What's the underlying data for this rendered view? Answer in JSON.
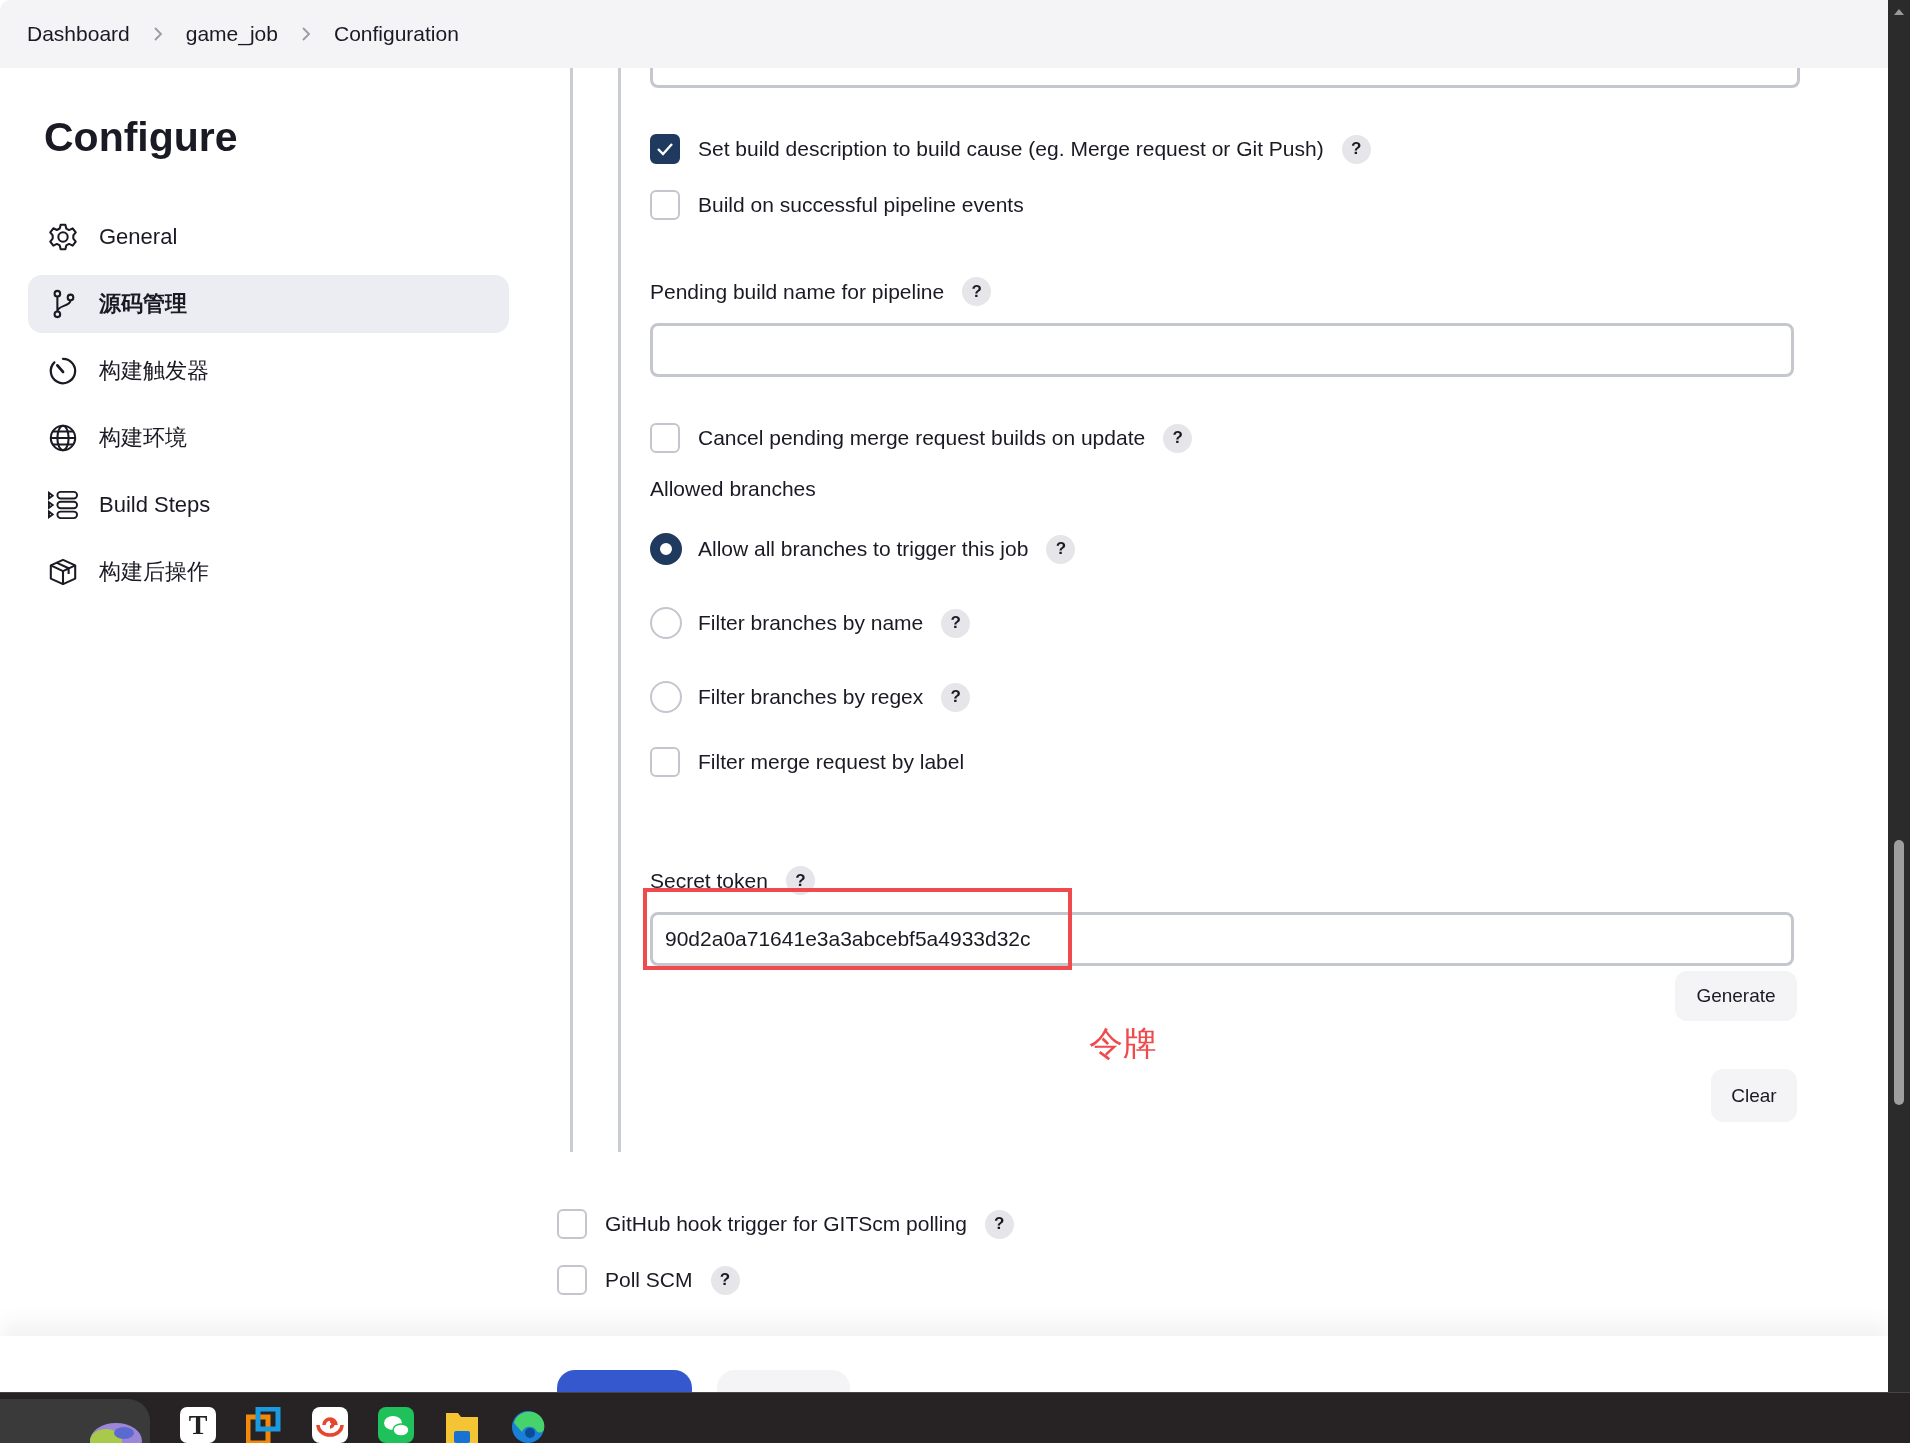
{
  "breadcrumbs": [
    "Dashboard",
    "game_job",
    "Configuration"
  ],
  "sidebar": {
    "title": "Configure",
    "items": [
      {
        "label": "General",
        "selected": false
      },
      {
        "label": "源码管理",
        "selected": true
      },
      {
        "label": "构建触发器",
        "selected": false
      },
      {
        "label": "构建环境",
        "selected": false
      },
      {
        "label": "Build Steps",
        "selected": false
      },
      {
        "label": "构建后操作",
        "selected": false
      }
    ]
  },
  "trigger_options": [
    {
      "kind": "checkbox",
      "label": "Set build description to build cause (eg. Merge request or Git Push)",
      "checked": true,
      "help": "?"
    },
    {
      "kind": "checkbox",
      "label": "Build on successful pipeline events",
      "checked": false
    },
    {
      "kind": "field",
      "label": "Pending build name for pipeline",
      "help": "?"
    },
    {
      "kind": "checkbox",
      "label": "Cancel pending merge request builds on update",
      "checked": false,
      "help": "?"
    },
    {
      "kind": "heading",
      "label": "Allowed branches"
    },
    {
      "kind": "radio",
      "label": "Allow all branches to trigger this job",
      "selected": true,
      "help": "?"
    },
    {
      "kind": "radio",
      "label": "Filter branches by name",
      "selected": false,
      "help": "?"
    },
    {
      "kind": "radio",
      "label": "Filter branches by regex",
      "selected": false,
      "help": "?"
    },
    {
      "kind": "checkbox",
      "label": "Filter merge request by label",
      "checked": false
    },
    {
      "kind": "token",
      "label": "Secret token",
      "help": "?",
      "value": "90d2a0a71641e3a3abcebf5a4933d32c",
      "buttons": [
        "Generate",
        "Clear"
      ]
    }
  ],
  "annotation": {
    "text": "令牌"
  },
  "outer_options": [
    {
      "label": "GitHub hook trigger for GITScm polling",
      "checked": false,
      "help": "?"
    },
    {
      "label": "Poll SCM",
      "checked": false,
      "help": "?"
    }
  ],
  "footer_buttons": [
    {
      "kind": "primary"
    },
    {
      "kind": "secondary"
    }
  ],
  "taskbar": {
    "apps": [
      {
        "kind": "widget"
      },
      {
        "kind": "text",
        "glyph": "T"
      },
      {
        "kind": "squares"
      },
      {
        "kind": "swirl"
      },
      {
        "kind": "chat"
      },
      {
        "kind": "folder"
      },
      {
        "kind": "browser"
      }
    ]
  }
}
